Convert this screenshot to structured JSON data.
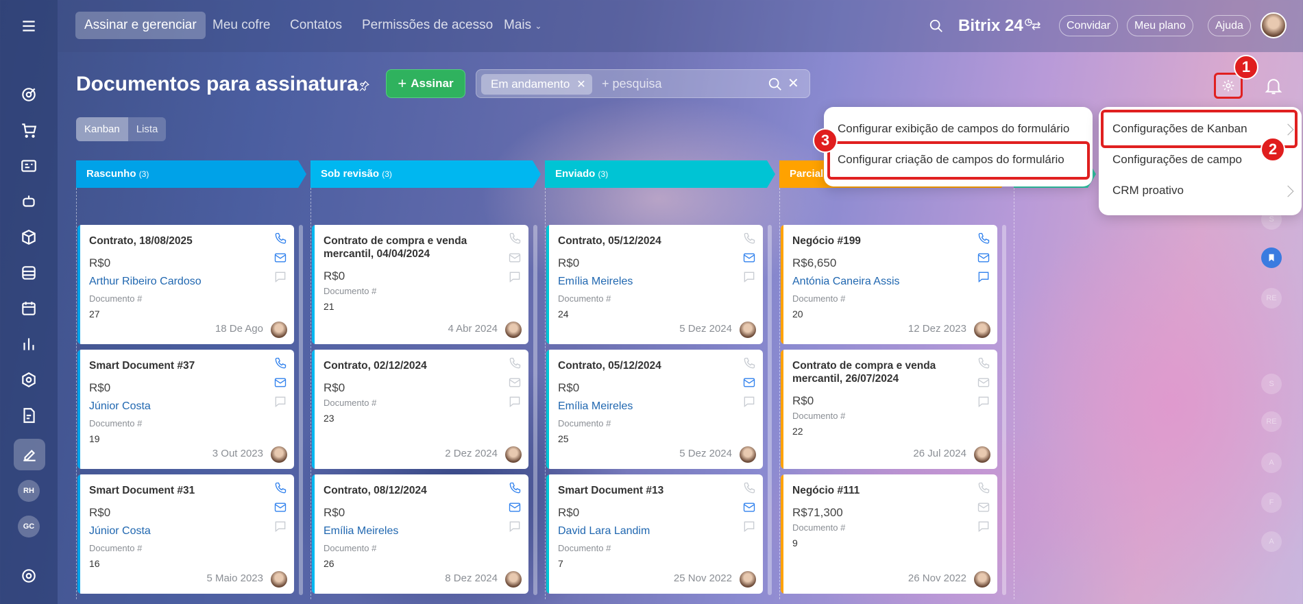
{
  "colors": {
    "accent_green": "#2fb25e",
    "highlight_red": "#e02020",
    "link_blue": "#2067b0",
    "col_rascunho": "#00a2e8",
    "col_revisao": "#00b7f0",
    "col_enviado": "#00c4d4",
    "col_parcial": "#ffa200"
  },
  "topnav": {
    "items": [
      "Assinar e gerenciar",
      "Meu cofre",
      "Contatos",
      "Permissões de acesso",
      "Mais"
    ],
    "brand": "Bitrix 24",
    "invite": "Convidar",
    "plan": "Meu plano",
    "help": "Ajuda"
  },
  "sidebar": {
    "avatars": [
      "RH",
      "GC"
    ],
    "icons": [
      "menu-icon",
      "target-icon",
      "cart-icon",
      "contact-card-icon",
      "robot-icon",
      "box-icon",
      "archive-icon",
      "calendar-icon",
      "chart-icon",
      "hexagon-icon",
      "document-edit-icon",
      "sign-icon",
      "settings-icon"
    ]
  },
  "header": {
    "title": "Documentos para assinatura",
    "sign_button": "Assinar",
    "filter_chip": "Em andamento",
    "search_placeholder": "+ pesquisa"
  },
  "views": [
    "Kanban",
    "Lista"
  ],
  "columns": [
    {
      "name": "Rascunho",
      "count": "(3)",
      "cards": [
        {
          "title": "Contrato, 18/08/2025",
          "amount": "R$0",
          "client": "Arthur Ribeiro Cardoso",
          "field_label": "Documento #",
          "field_value": "27",
          "date": "18 De Ago"
        },
        {
          "title": "Smart Document #37",
          "amount": "R$0",
          "client": "Júnior Costa",
          "field_label": "Documento #",
          "field_value": "19",
          "date": "3 Out 2023"
        },
        {
          "title": "Smart Document #31",
          "amount": "R$0",
          "client": "Júnior Costa",
          "field_label": "Documento #",
          "field_value": "16",
          "date": "5 Maio 2023"
        }
      ]
    },
    {
      "name": "Sob revisão",
      "count": "(3)",
      "cards": [
        {
          "title": "Contrato de compra e venda mercantil, 04/04/2024",
          "amount": "R$0",
          "client": "",
          "field_label": "Documento #",
          "field_value": "21",
          "date": "4 Abr 2024"
        },
        {
          "title": "Contrato, 02/12/2024",
          "amount": "R$0",
          "client": "",
          "field_label": "Documento #",
          "field_value": "23",
          "date": "2 Dez 2024"
        },
        {
          "title": "Contrato, 08/12/2024",
          "amount": "R$0",
          "client": "Emília Meireles",
          "field_label": "Documento #",
          "field_value": "26",
          "date": "8 Dez 2024"
        }
      ]
    },
    {
      "name": "Enviado",
      "count": "(3)",
      "cards": [
        {
          "title": "Contrato, 05/12/2024",
          "amount": "R$0",
          "client": "Emília Meireles",
          "field_label": "Documento #",
          "field_value": "24",
          "date": "5 Dez 2024"
        },
        {
          "title": "Contrato, 05/12/2024",
          "amount": "R$0",
          "client": "Emília Meireles",
          "field_label": "Documento #",
          "field_value": "25",
          "date": "5 Dez 2024"
        },
        {
          "title": "Smart Document #13",
          "amount": "R$0",
          "client": "David Lara Landim",
          "field_label": "Documento #",
          "field_value": "7",
          "date": "25 Nov 2022"
        }
      ]
    },
    {
      "name": "Parcialm",
      "count": "",
      "cards": [
        {
          "title": "Negócio #199",
          "amount": "R$6,650",
          "client": "Antónia Caneira Assis",
          "field_label": "Documento #",
          "field_value": "20",
          "date": "12 Dez 2023"
        },
        {
          "title": "Contrato de compra e venda mercantil, 26/07/2024",
          "amount": "R$0",
          "client": "",
          "field_label": "Documento #",
          "field_value": "22",
          "date": "26 Jul 2024"
        },
        {
          "title": "Negócio #111",
          "amount": "R$71,300",
          "client": "",
          "field_label": "Documento #",
          "field_value": "9",
          "date": "26 Nov 2022"
        }
      ]
    }
  ],
  "menu_form": {
    "items": [
      "Configurar exibição de campos do formulário",
      "Configurar criação de campos do formulário"
    ]
  },
  "menu_settings": {
    "items": [
      "Configurações de Kanban",
      "Configurações de campo",
      "CRM proativo"
    ]
  },
  "badges": [
    "1",
    "2",
    "3"
  ],
  "right_rail": [
    "S",
    "RE",
    "S",
    "RE",
    "A",
    "F",
    "A"
  ]
}
